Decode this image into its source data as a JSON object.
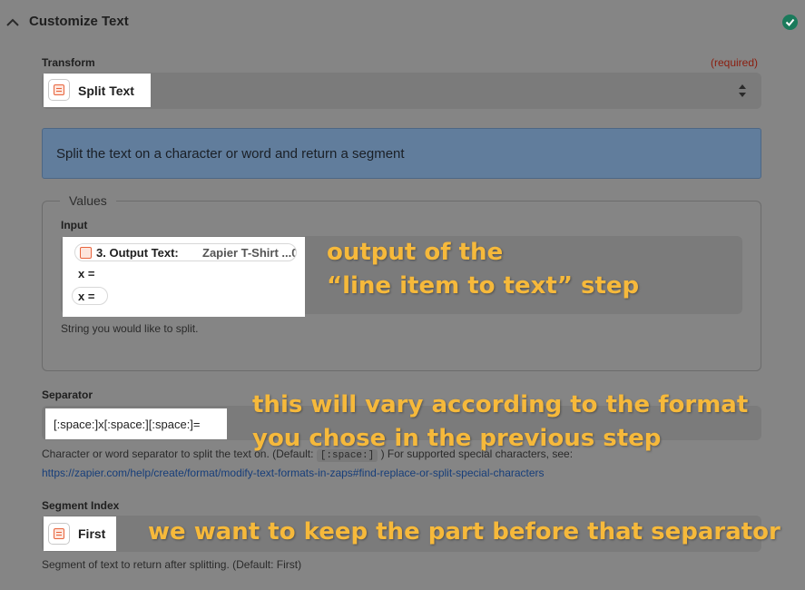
{
  "header": {
    "title": "Customize Text"
  },
  "transform": {
    "label": "Transform",
    "required": "(required)",
    "value": "Split Text",
    "description": "Split the text on a character or word and return a segment"
  },
  "values": {
    "legend": "Values",
    "input": {
      "label": "Input",
      "pill_step": "3. Output Text:",
      "pill_value": "Zapier T-Shirt ...0",
      "line2": "x =",
      "line3": "x =",
      "help": "String you would like to split."
    }
  },
  "separator": {
    "label": "Separator",
    "value": "[:space:]x[:space:][:space:]=",
    "help_prefix": "Character or word separator to split the text on. (Default:",
    "help_code": "[:space:]",
    "help_suffix": ") For supported special characters, see:",
    "link": "https://zapier.com/help/create/format/modify-text-formats-in-zaps#find-replace-or-split-special-characters"
  },
  "segment_index": {
    "label": "Segment Index",
    "value": "First",
    "help": "Segment of text to return after splitting. (Default: First)"
  },
  "annotations": {
    "input_line1": "output of the",
    "input_line2": "“line item to text” step",
    "separator_line1": "this will vary according to the format",
    "separator_line2": "you chose in the previous step",
    "segment": "we want to keep the part before that separator"
  },
  "colors": {
    "background": "#858585",
    "annotation": "#f6b93b",
    "check": "#1a7a5b",
    "info_box": "#617d9c",
    "required": "#8b1d0e",
    "icon_accent": "#e8643d"
  },
  "icons": [
    "chevron-up-icon",
    "check-circle-icon",
    "formatter-app-icon",
    "select-arrows-icon"
  ]
}
